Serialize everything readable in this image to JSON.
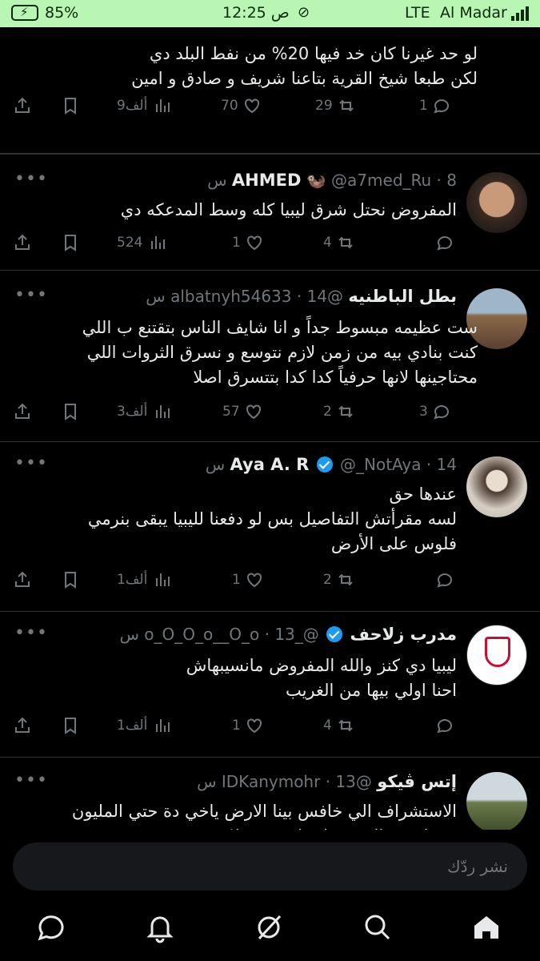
{
  "status_bar": {
    "battery": "85%",
    "time": "12:25 ص",
    "network": "LTE",
    "carrier": "Al Madar"
  },
  "tweets": [
    {
      "id": "t0",
      "body": "لو حد غيرنا كان خد فيها 20% من نفط البلد دي\nلكن طبعا شيخ القرية بتاعنا شريف و صادق و امين",
      "replies": "1",
      "reposts": "29",
      "likes": "70",
      "views": "9ألف"
    },
    {
      "id": "t1",
      "name": "AHMED",
      "name_emoji": "🦦",
      "handle": "@a7med_Ru",
      "time": "8 س",
      "verified": false,
      "body": "المفروض نحتل شرق ليبيا كله وسط المدعكه دي",
      "replies": "",
      "reposts": "4",
      "likes": "1",
      "views": "524"
    },
    {
      "id": "t2",
      "name": "بطل الباطنيه",
      "handle": "@albatnyh54633",
      "time": "14 س",
      "verified": false,
      "body": "ست عظيمه مبسوط جداً و انا شايف الناس بتقتنع ب اللي\nكنت بنادي بيه من زمن لازم نتوسع و نسرق الثروات اللي\nمحتاجينها لانها حرفياً كدا كدا بتتسرق اصلا",
      "replies": "3",
      "reposts": "2",
      "likes": "57",
      "views": "3ألف"
    },
    {
      "id": "t3",
      "name": "Aya A. R",
      "handle": "@_NotAya",
      "time": "14 س",
      "verified": true,
      "body": "عندها حق\nلسه مقرأتش التفاصيل بس لو دفعنا لليبيا يبقى بنرمي\nفلوس على الأرض",
      "replies": "",
      "reposts": "2",
      "likes": "1",
      "views": "1ألف"
    },
    {
      "id": "t4",
      "name": "مدرب زلاحف",
      "handle": "@_o_O_O_o__O_o",
      "time": "13 س",
      "verified": true,
      "body": "ليبيا دي كنز والله المفروض مانسيبهاش\nاحنا اولي بيها من الغريب",
      "replies": "",
      "reposts": "4",
      "likes": "1",
      "views": "1ألف"
    },
    {
      "id": "t5",
      "name": "إتس ڤيكو",
      "handle": "@IDKanymohr",
      "time": "13 س",
      "verified": false,
      "body": "الاستشراف الي خافس بينا الارض ياخي دة حتي المليون\nبرميل في الشهر ولا حاجة حرفيا!"
    }
  ],
  "reply_bar": {
    "placeholder": "نشر ردّك"
  },
  "nav": [
    "chat-icon",
    "bell-icon",
    "grok-icon",
    "search-icon",
    "home-icon"
  ],
  "colors": {
    "status_bar_bg": "#b9f5b3",
    "background": "#000000",
    "muted": "#71767b",
    "verified": "#1d9bf0"
  }
}
